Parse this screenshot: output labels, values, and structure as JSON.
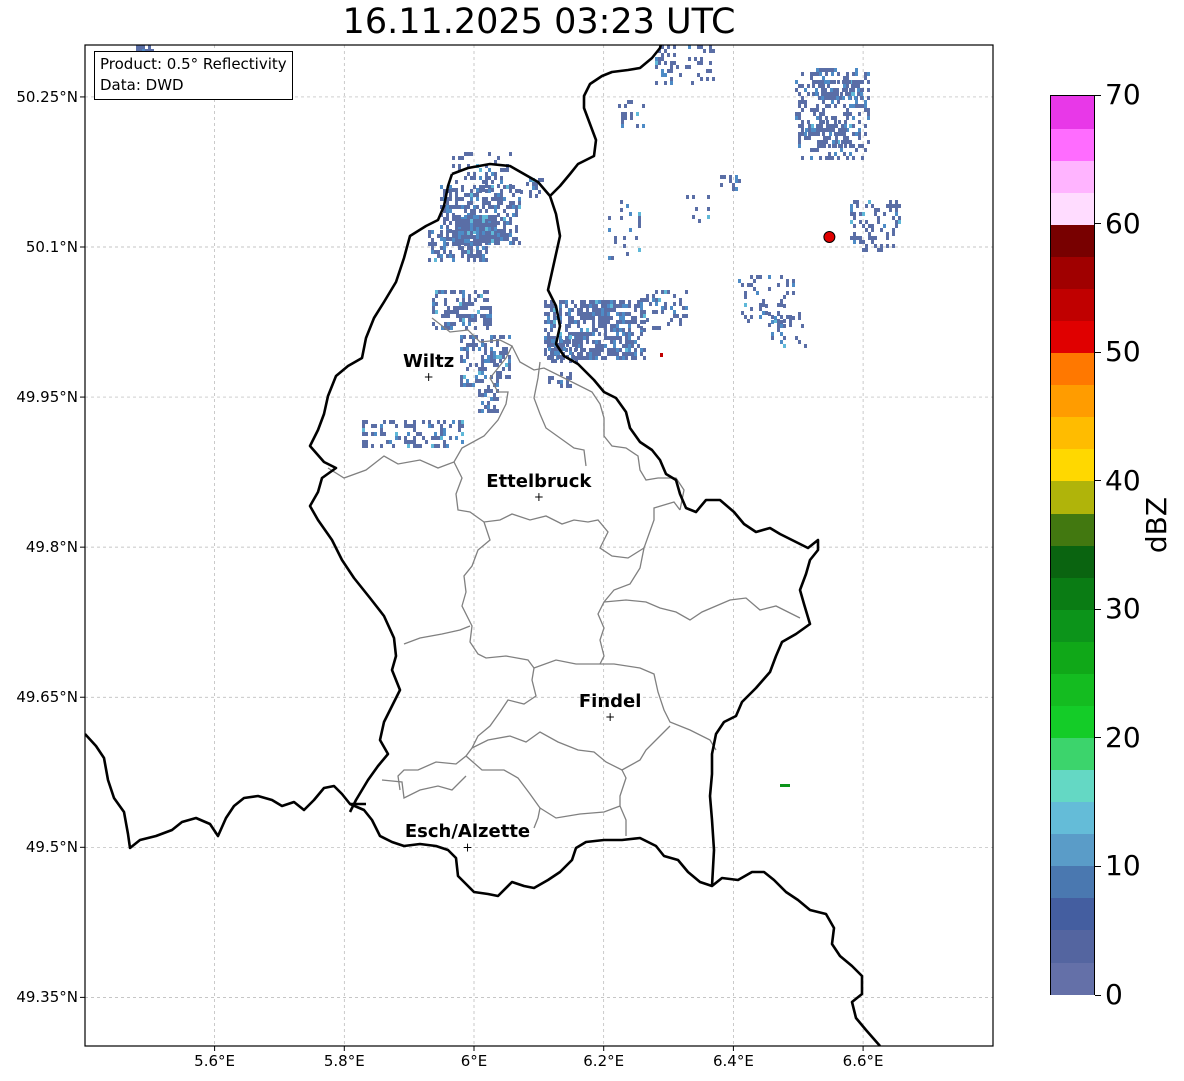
{
  "title": "16.11.2025 03:23 UTC",
  "info": {
    "product": "Product: 0.5° Reflectivity",
    "data": "Data: DWD"
  },
  "lat_ticks": [
    {
      "value": 50.25,
      "label": "50.25°N"
    },
    {
      "value": 50.1,
      "label": "50.1°N"
    },
    {
      "value": 49.95,
      "label": "49.95°N"
    },
    {
      "value": 49.8,
      "label": "49.8°N"
    },
    {
      "value": 49.65,
      "label": "49.65°N"
    },
    {
      "value": 49.5,
      "label": "49.5°N"
    },
    {
      "value": 49.35,
      "label": "49.35°N"
    }
  ],
  "lon_ticks": [
    {
      "value": 5.6,
      "label": "5.6°E"
    },
    {
      "value": 5.8,
      "label": "5.8°E"
    },
    {
      "value": 6.0,
      "label": "6°E"
    },
    {
      "value": 6.2,
      "label": "6.2°E"
    },
    {
      "value": 6.4,
      "label": "6.4°E"
    },
    {
      "value": 6.6,
      "label": "6.6°E"
    }
  ],
  "cities": [
    {
      "name": "Wiltz",
      "lon": 5.93,
      "lat": 49.97
    },
    {
      "name": "Ettelbruck",
      "lon": 6.1,
      "lat": 49.85
    },
    {
      "name": "Findel",
      "lon": 6.21,
      "lat": 49.63
    },
    {
      "name": "Esch/Alzette",
      "lon": 5.99,
      "lat": 49.5
    }
  ],
  "radar_site": {
    "lon": 6.548,
    "lat": 50.11,
    "color": "#e00000"
  },
  "colorbar": {
    "unit": "dBZ",
    "min": 0,
    "max": 70,
    "ticks": [
      "0",
      "10",
      "20",
      "30",
      "40",
      "50",
      "60",
      "70"
    ],
    "colors": [
      "#6470a8",
      "#5465a0",
      "#445ea0",
      "#4a78b0",
      "#5a9cc8",
      "#64bcd8",
      "#64d8c4",
      "#3cd46c",
      "#14cc28",
      "#14bc20",
      "#10a818",
      "#0c941a",
      "#0a7c14",
      "#0a6410",
      "#427810",
      "#b0b40a",
      "#ffd800",
      "#ffbc00",
      "#ff9c00",
      "#ff7800",
      "#e00000",
      "#c00000",
      "#a00000",
      "#780000",
      "#ffdcff",
      "#ffb4ff",
      "#ff6cff",
      "#e838e8"
    ]
  },
  "colors": {
    "border": "#000000",
    "canton": "#808080",
    "grid": "#b4b4b4",
    "echo": "#5a6ea6",
    "echo_strong": "#4d8bc6",
    "echo_core": "#5fb8d8"
  }
}
